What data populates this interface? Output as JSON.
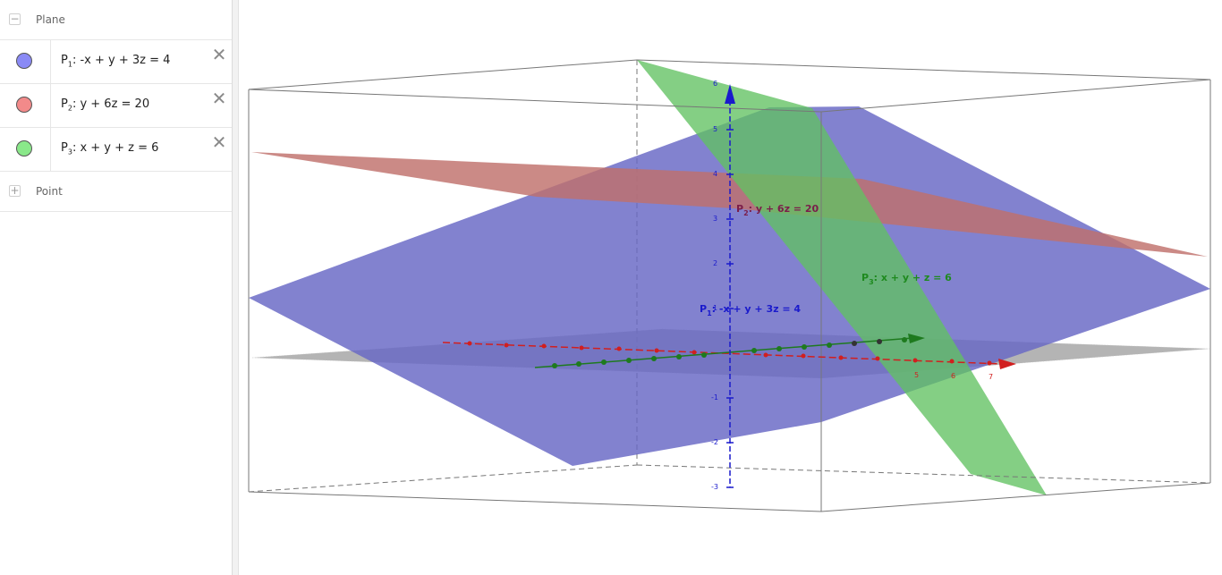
{
  "algebra_view": {
    "plane_group": {
      "label": "Plane",
      "toggle": "−"
    },
    "planes": [
      {
        "name": "P",
        "index": "1",
        "equation": ": -x + y + 3z = 4",
        "color": "#8a8af5"
      },
      {
        "name": "P",
        "index": "2",
        "equation": ": y + 6z = 20",
        "color": "#f28a8a"
      },
      {
        "name": "P",
        "index": "3",
        "equation": ": x + y + z = 6",
        "color": "#8ae88a"
      }
    ],
    "point_group": {
      "label": "Point",
      "toggle": "+"
    }
  },
  "graphics_view": {
    "labels": {
      "p1": {
        "name": "P",
        "index": "1",
        "text": ": -x + y + 3z = 4"
      },
      "p2": {
        "name": "P",
        "index": "2",
        "text": ": y + 6z = 20"
      },
      "p3": {
        "name": "P",
        "index": "3",
        "text": ": x + y + z = 6"
      }
    },
    "z_ticks": [
      "6",
      "5",
      "4",
      "3",
      "2",
      "1",
      "-1",
      "-2",
      "-3"
    ],
    "x_ticks": [
      "5",
      "6",
      "7"
    ],
    "colors": {
      "plane1": "#6666c4",
      "plane2": "#c0706b",
      "plane3": "#62c162",
      "x_axis": "#d11f1f",
      "y_axis": "#1e7a1e",
      "z_axis": "#1a1acc"
    }
  }
}
